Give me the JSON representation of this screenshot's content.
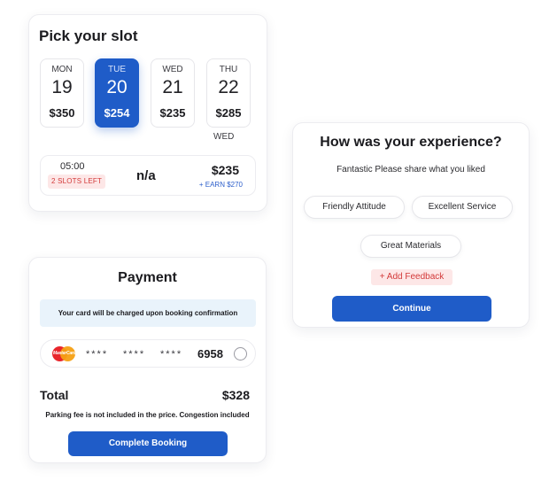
{
  "slot": {
    "title": "Pick your slot",
    "days": [
      {
        "dow": "MON",
        "date": "19",
        "price": "$350",
        "selected": false
      },
      {
        "dow": "TUE",
        "date": "20",
        "price": "$254",
        "selected": true
      },
      {
        "dow": "WED",
        "date": "21",
        "price": "$235",
        "selected": false
      },
      {
        "dow": "THU",
        "date": "22",
        "price": "$285",
        "selected": false
      }
    ],
    "sub_label": "WED",
    "row": {
      "time": "05:00",
      "badge": "2 SLOTS LEFT",
      "middle": "n/a",
      "price": "$235",
      "earn": "+ EARN $270"
    }
  },
  "experience": {
    "title": "How was your experience?",
    "subtitle": "Fantastic Please share what you liked",
    "chips": [
      "Friendly Attitude",
      "Excellent Service",
      "Great Materials"
    ],
    "add_feedback": "+ Add Feedback",
    "continue": "Continue"
  },
  "payment": {
    "title": "Payment",
    "notice": "Your card will be charged upon booking confirmation",
    "card": {
      "brand_icon": "mastercard-icon",
      "brand_text": "MasterCard",
      "masked": [
        "****",
        "****",
        "****"
      ],
      "last4": "6958"
    },
    "total_label": "Total",
    "total_value": "$328",
    "fee_note": "Parking fee is not included in the price. Congestion included",
    "complete": "Complete Booking"
  },
  "colors": {
    "primary": "#1f5cc8",
    "badge_bg": "#fde7e7",
    "badge_text": "#d33a3a",
    "notice_bg": "#e9f3fb"
  }
}
